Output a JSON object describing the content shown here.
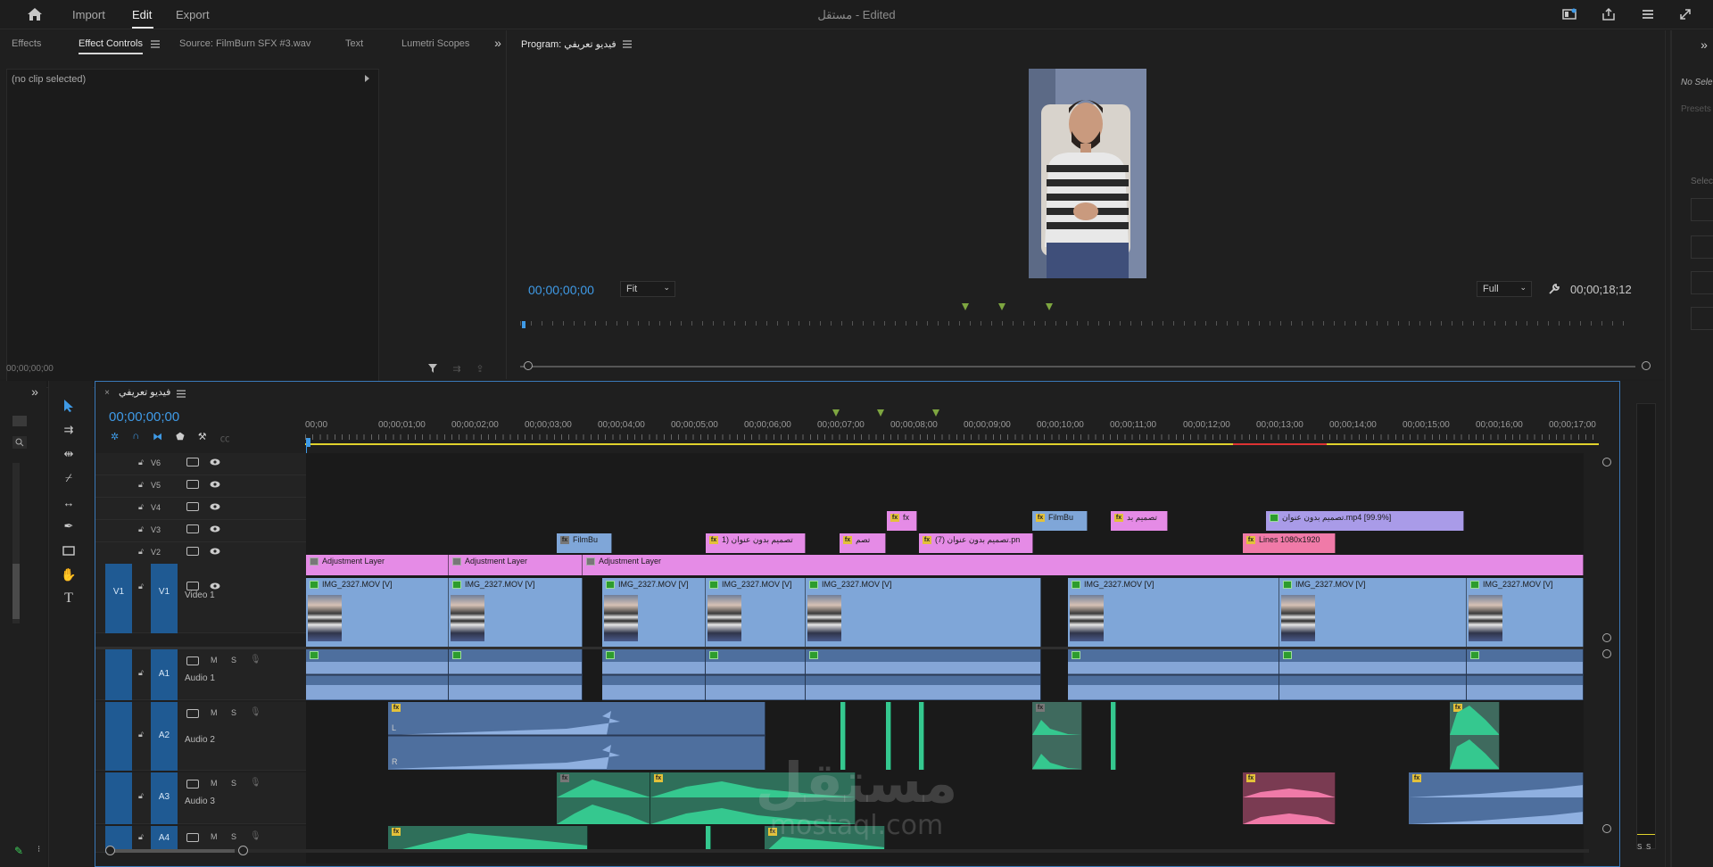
{
  "topbar": {
    "home_icon": "home-icon",
    "tabs": [
      {
        "label": "Import"
      },
      {
        "label": "Edit"
      },
      {
        "label": "Export"
      }
    ],
    "title": "مستقل",
    "title_status": "- Edited",
    "right_icons": [
      "workspace-icon",
      "share-icon",
      "menu-icon",
      "fullscreen-icon"
    ]
  },
  "left_panel": {
    "tabs": [
      {
        "label": "Effects"
      },
      {
        "label": "Effect Controls"
      },
      {
        "label": "Source: FilmBurn SFX #3.wav"
      },
      {
        "label": "Text"
      },
      {
        "label": "Lumetri Scopes"
      }
    ],
    "no_clip": "(no clip selected)",
    "timecode": "00;00;00;00"
  },
  "program": {
    "title": "Program: فيديو تعريفي",
    "timecode_left": "00;00;00;00",
    "fit": "Fit",
    "quality": "Full",
    "timecode_right": "00;00;18;12"
  },
  "timeline": {
    "sequence_name": "فيديو تعريفي",
    "timecode": "00;00;00;00",
    "ruler": [
      "00;00",
      "00;00;01;00",
      "00;00;02;00",
      "00;00;03;00",
      "00;00;04;00",
      "00;00;05;00",
      "00;00;06;00",
      "00;00;07;00",
      "00;00;08;00",
      "00;00;09;00",
      "00;00;10;00",
      "00;00;11;00",
      "00;00;12;00",
      "00;00;13;00",
      "00;00;14;00",
      "00;00;15;00",
      "00;00;16;00",
      "00;00;17;00"
    ],
    "video_tracks": [
      {
        "name": "V6"
      },
      {
        "name": "V5"
      },
      {
        "name": "V4"
      },
      {
        "name": "V3"
      },
      {
        "name": "V2"
      },
      {
        "name": "V1",
        "label": "Video 1",
        "src": "V1"
      }
    ],
    "audio_tracks": [
      {
        "name": "A1",
        "label": "Audio 1"
      },
      {
        "name": "A2",
        "label": "Audio 2"
      },
      {
        "name": "A3",
        "label": "Audio 3"
      },
      {
        "name": "A4"
      }
    ],
    "track_btn_m": "M",
    "track_btn_s": "S",
    "clips": {
      "v4": [
        "fx",
        "FilmBu",
        "تصميم بد",
        "تصميم بدون عنوان.mp4 [99.9%]"
      ],
      "v3": [
        "FilmBu",
        "تصميم بدون عنوان (1",
        "تصم",
        "تصميم بدون عنوان (7).pn",
        "Lines 1080x1920"
      ],
      "v2": [
        "Adjustment Layer",
        "Adjustment Layer",
        "Adjustment Layer"
      ],
      "v1": "IMG_2327.MOV [V]"
    },
    "audio_labels": {
      "left": "L",
      "right": "R"
    }
  },
  "right_panel": {
    "no_sel": "No Sele",
    "preset": "Presets",
    "select": "Selec"
  },
  "watermark": {
    "arabic": "مستقل",
    "latin": "mostaql.com"
  },
  "meter_labels": {
    "s1": "S",
    "s2": "S"
  },
  "colors": {
    "accent_blue": "#3f9ae6",
    "video_clip": "#7fa6d8",
    "adjustment_layer": "#e58be6",
    "audio_blue": "#4e6f9e",
    "audio_green": "#35c88f",
    "marker_green": "#7ea640"
  }
}
